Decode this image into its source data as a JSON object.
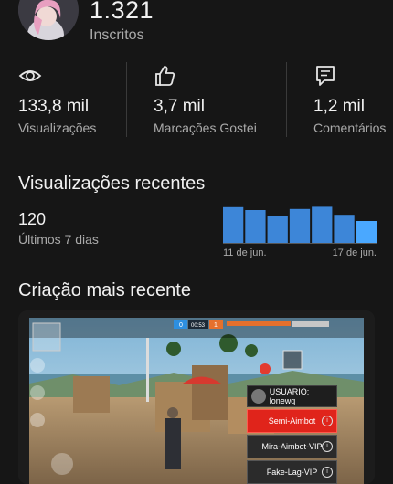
{
  "channel": {
    "subscribers_count": "1.321",
    "subscribers_label": "Inscritos"
  },
  "stats": [
    {
      "icon": "eye-icon",
      "value": "133,8 mil",
      "label": "Visualizações"
    },
    {
      "icon": "thumbs-up-icon",
      "value": "3,7 mil",
      "label": "Marcações Gostei"
    },
    {
      "icon": "comment-icon",
      "value": "1,2 mil",
      "label": "Comentários"
    }
  ],
  "recent_views": {
    "title": "Visualizações recentes",
    "value": "120",
    "period": "Últimos 7 dias"
  },
  "chart_data": {
    "type": "bar",
    "categories": [
      "",
      "",
      "",
      "",
      "",
      "",
      ""
    ],
    "values": [
      0.98,
      0.9,
      0.73,
      0.93,
      0.99,
      0.77,
      0.6
    ],
    "tick_labels": [
      "11 de jun.",
      "17 de jun."
    ],
    "grid": false,
    "colors": [
      "#3d86d8",
      "#3d86d8",
      "#3d86d8",
      "#3d86d8",
      "#3d86d8",
      "#3d86d8",
      "#4aa8ff"
    ]
  },
  "latest_creation": {
    "title": "Criação mais recente",
    "overlay_menu": {
      "user": "USUARIO: lonewq",
      "items": [
        "Semi-Aimbot",
        "Mira-Aimbot-VIP",
        "Fake-Lag-VIP"
      ],
      "info_glyph": "i"
    },
    "hud": {
      "left_count": "0",
      "timer": "00:53",
      "right_count": "1"
    }
  }
}
